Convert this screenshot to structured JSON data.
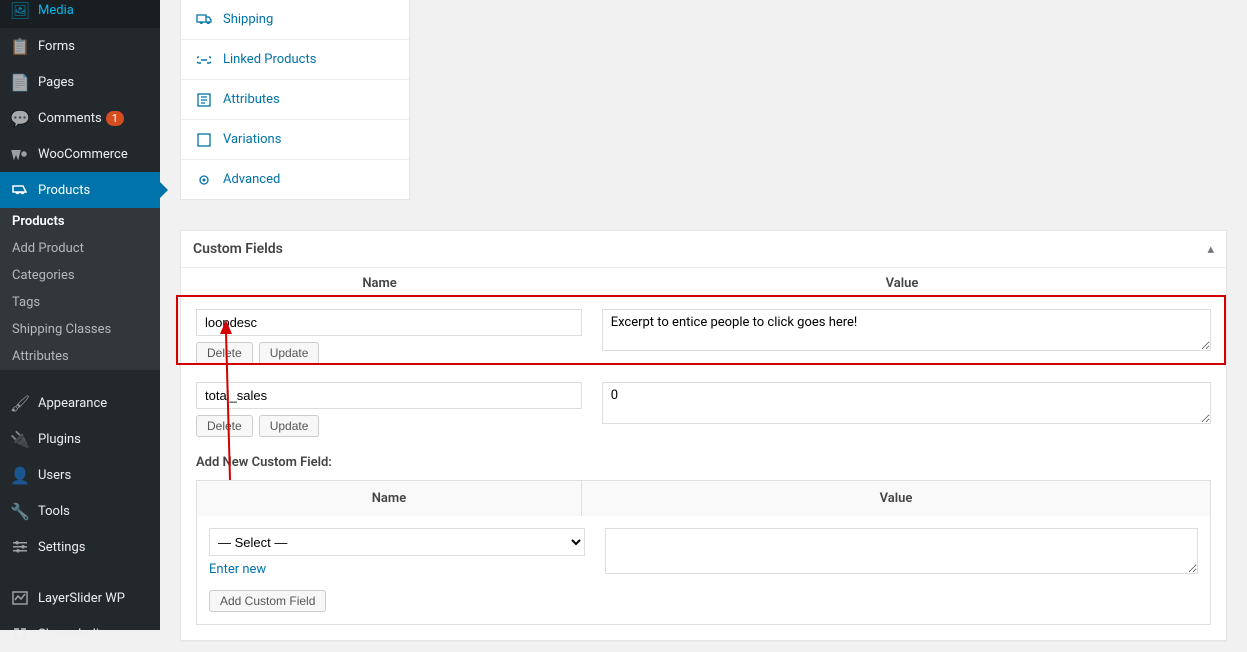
{
  "sidebar": {
    "media": "Media",
    "forms": "Forms",
    "pages": "Pages",
    "comments": "Comments",
    "comments_badge": "1",
    "woocommerce": "WooCommerce",
    "products": "Products",
    "products_sub": [
      "Products",
      "Add Product",
      "Categories",
      "Tags",
      "Shipping Classes",
      "Attributes"
    ],
    "appearance": "Appearance",
    "plugins": "Plugins",
    "users": "Users",
    "tools": "Tools",
    "settings": "Settings",
    "layerslider": "LayerSlider WP",
    "shareaholic": "Shareaholic"
  },
  "pd_tabs": {
    "shipping": "Shipping",
    "linked": "Linked Products",
    "attributes": "Attributes",
    "variations": "Variations",
    "advanced": "Advanced"
  },
  "custom_fields": {
    "title": "Custom Fields",
    "name_header": "Name",
    "value_header": "Value",
    "rows": [
      {
        "name": "loopdesc",
        "value": "Excerpt to entice people to click goes here!"
      },
      {
        "name": "total_sales",
        "value": "0"
      }
    ],
    "delete_btn": "Delete",
    "update_btn": "Update",
    "addnew_label": "Add New Custom Field:",
    "new_name_header": "Name",
    "new_value_header": "Value",
    "select_placeholder": "— Select —",
    "enter_new": "Enter new",
    "add_button": "Add Custom Field"
  }
}
